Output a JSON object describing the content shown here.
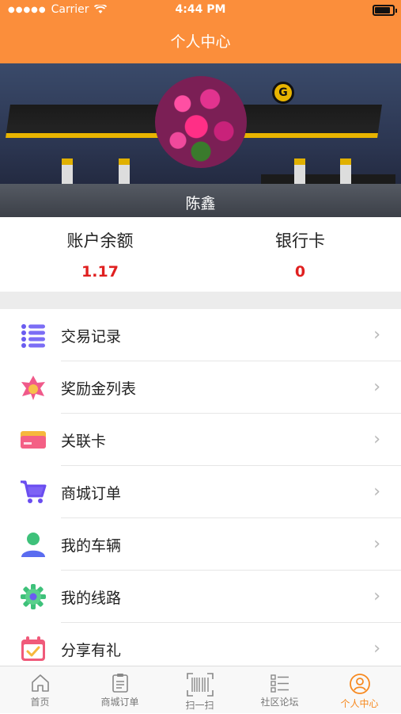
{
  "status_bar": {
    "carrier": "Carrier",
    "time": "4:44 PM"
  },
  "header": {
    "title": "个人中心"
  },
  "profile": {
    "name": "陈鑫"
  },
  "stats": {
    "balance_label": "账户余额",
    "balance_value": "1.17",
    "bank_label": "银行卡",
    "bank_value": "0"
  },
  "menu": [
    {
      "label": "交易记录",
      "icon": "list-icon"
    },
    {
      "label": "奖励金列表",
      "icon": "reward-icon"
    },
    {
      "label": "关联卡",
      "icon": "card-icon"
    },
    {
      "label": "商城订单",
      "icon": "cart-icon"
    },
    {
      "label": "我的车辆",
      "icon": "user-icon"
    },
    {
      "label": "我的线路",
      "icon": "gear-icon"
    },
    {
      "label": "分享有礼",
      "icon": "calendar-check-icon"
    }
  ],
  "tabs": [
    {
      "label": "首页",
      "icon": "home-icon"
    },
    {
      "label": "商城订单",
      "icon": "clipboard-icon"
    },
    {
      "label": "扫一扫",
      "icon": "barcode-scan-icon"
    },
    {
      "label": "社区论坛",
      "icon": "forum-list-icon"
    },
    {
      "label": "个人中心",
      "icon": "profile-icon",
      "active": true
    }
  ],
  "colors": {
    "accent": "#fb8e3b",
    "value_red": "#e02020",
    "tab_active": "#f7891f"
  }
}
